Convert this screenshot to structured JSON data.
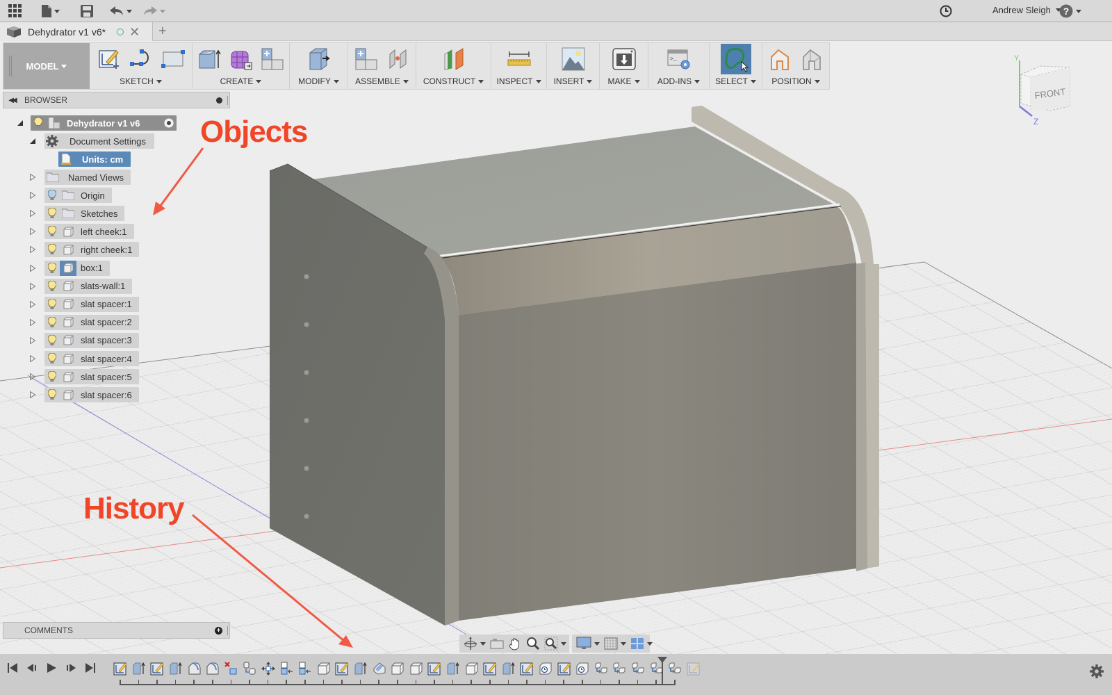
{
  "appbar": {
    "grid_icon": "apps-grid-icon",
    "file_icon": "file-icon",
    "save_icon": "save-icon",
    "undo_icon": "undo-icon",
    "redo_icon": "redo-icon",
    "clock_icon": "job-status-icon",
    "user_name": "Andrew Sleigh",
    "help_icon": "help-icon"
  },
  "tabs": [
    {
      "title": "Dehydrator v1 v6*",
      "status": "saved-indicator",
      "active": true
    }
  ],
  "toolbar": {
    "workspace": "MODEL",
    "groups": [
      {
        "label": "SKETCH",
        "icons": [
          "create-sketch-icon",
          "line-spline-icon",
          "rectangle-icon"
        ]
      },
      {
        "label": "CREATE",
        "icons": [
          "extrude-icon",
          "create-form-icon",
          "new-component-icon"
        ]
      },
      {
        "label": "MODIFY",
        "icons": [
          "press-pull-icon"
        ]
      },
      {
        "label": "ASSEMBLE",
        "icons": [
          "new-component-icon",
          "joint-icon"
        ]
      },
      {
        "label": "CONSTRUCT",
        "icons": [
          "offset-plane-icon"
        ]
      },
      {
        "label": "INSPECT",
        "icons": [
          "measure-icon"
        ]
      },
      {
        "label": "INSERT",
        "icons": [
          "insert-image-icon"
        ]
      },
      {
        "label": "MAKE",
        "icons": [
          "3d-print-icon"
        ]
      },
      {
        "label": "ADD-INS",
        "icons": [
          "scripts-addins-icon"
        ]
      },
      {
        "label": "SELECT",
        "icons": [
          "lasso-select-icon"
        ]
      },
      {
        "label": "POSITION",
        "icons": [
          "capture-position-icon",
          "revert-position-icon"
        ]
      }
    ]
  },
  "browser": {
    "title": "BROWSER",
    "root": "Dehydrator v1 v6",
    "document_settings": "Document Settings",
    "units": "Units: cm",
    "items": [
      {
        "label": "Named Views",
        "type": "folder",
        "visible": null
      },
      {
        "label": "Origin",
        "type": "folder",
        "visible": "off"
      },
      {
        "label": "Sketches",
        "type": "folder",
        "visible": "on"
      },
      {
        "label": "left cheek:1",
        "type": "component",
        "visible": "on"
      },
      {
        "label": "right cheek:1",
        "type": "component",
        "visible": "on"
      },
      {
        "label": "box:1",
        "type": "component",
        "visible": "on",
        "selected": true
      },
      {
        "label": "slats-wall:1",
        "type": "component",
        "visible": "on"
      },
      {
        "label": "slat spacer:1",
        "type": "component",
        "visible": "on"
      },
      {
        "label": "slat spacer:2",
        "type": "component",
        "visible": "on"
      },
      {
        "label": "slat spacer:3",
        "type": "component",
        "visible": "on"
      },
      {
        "label": "slat spacer:4",
        "type": "component",
        "visible": "on"
      },
      {
        "label": "slat spacer:5",
        "type": "component",
        "visible": "on"
      },
      {
        "label": "slat spacer:6",
        "type": "component",
        "visible": "on"
      }
    ]
  },
  "annotations": {
    "objects": "Objects",
    "history": "History"
  },
  "viewcube": {
    "face": "FRONT",
    "axis_y": "Y",
    "axis_z": "Z"
  },
  "comments": {
    "title": "COMMENTS"
  },
  "navbar": [
    "orbit-icon",
    "look-at-icon",
    "pan-icon",
    "zoom-icon",
    "fit-icon",
    "display-settings-icon",
    "grid-settings-icon",
    "viewports-icon"
  ],
  "timeline": {
    "controls": [
      "go-to-start-icon",
      "step-back-icon",
      "play-icon",
      "step-forward-icon",
      "go-to-end-icon"
    ],
    "features": [
      "sketch",
      "extrude",
      "sketch",
      "extrude",
      "fillet",
      "fillet",
      "delete",
      "joint-origin",
      "move",
      "align",
      "align",
      "box",
      "sketch",
      "extrude",
      "split",
      "box",
      "box",
      "sketch",
      "extrude",
      "box",
      "sketch",
      "extrude",
      "sketch",
      "timer-box",
      "sketch",
      "timer-box",
      "joint",
      "joint",
      "joint",
      "joint",
      "joint",
      "sketch-suppressed"
    ],
    "settings_icon": "gear-icon"
  },
  "colors": {
    "accent_blue": "#4f7fae",
    "annotation_red": "#f04527",
    "selected_blue": "#5b8ab8"
  }
}
